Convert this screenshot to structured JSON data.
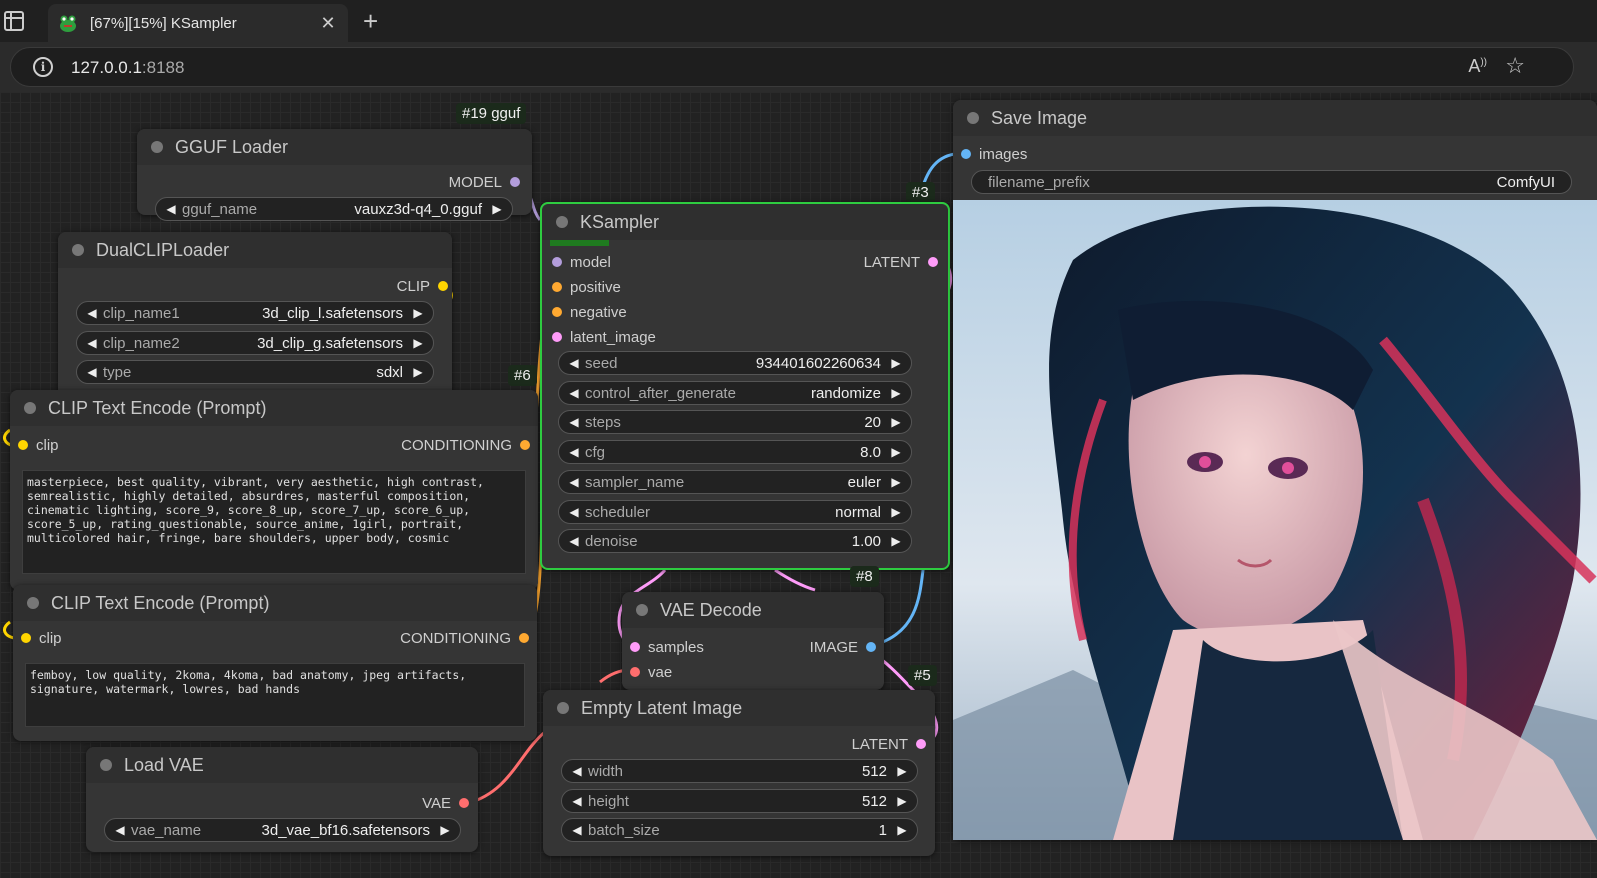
{
  "browser": {
    "tab_title": "[67%][15%] KSampler",
    "url_host": "127.0.0.1",
    "url_port": ":8188"
  },
  "nodes": {
    "gguf_loader": {
      "tag": "#19 gguf",
      "title": "GGUF Loader",
      "output": "MODEL",
      "widgets": [
        {
          "name": "gguf_name",
          "value": "vauxz3d-q4_0.gguf"
        }
      ]
    },
    "dualclip": {
      "title": "DualCLIPLoader",
      "output": "CLIP",
      "widgets": [
        {
          "name": "clip_name1",
          "value": "3d_clip_l.safetensors"
        },
        {
          "name": "clip_name2",
          "value": "3d_clip_g.safetensors"
        },
        {
          "name": "type",
          "value": "sdxl"
        }
      ]
    },
    "clip_pos": {
      "tag": "#6",
      "title": "CLIP Text Encode (Prompt)",
      "input": "clip",
      "output": "CONDITIONING",
      "text": "masterpiece, best quality, vibrant, very aesthetic, high contrast,\nsemrealistic, highly detailed, absurdres, masterful composition,\ncinematic lighting, score_9, score_8_up, score_7_up, score_6_up,\nscore_5_up, rating_questionable, source_anime, 1girl, portrait,\nmulticolored hair, fringe, bare shoulders, upper body, cosmic"
    },
    "clip_neg": {
      "title": "CLIP Text Encode (Prompt)",
      "input": "clip",
      "output": "CONDITIONING",
      "text": "femboy, low quality, 2koma, 4koma, bad anatomy, jpeg artifacts,\nsignature, watermark, lowres, bad hands"
    },
    "load_vae": {
      "title": "Load VAE",
      "output": "VAE",
      "widgets": [
        {
          "name": "vae_name",
          "value": "3d_vae_bf16.safetensors"
        }
      ]
    },
    "ksampler": {
      "tag": "#3",
      "title": "KSampler",
      "progress": 0.15,
      "inputs": [
        "model",
        "positive",
        "negative",
        "latent_image"
      ],
      "output": "LATENT",
      "widgets": [
        {
          "name": "seed",
          "value": "934401602260634"
        },
        {
          "name": "control_after_generate",
          "value": "randomize"
        },
        {
          "name": "steps",
          "value": "20"
        },
        {
          "name": "cfg",
          "value": "8.0"
        },
        {
          "name": "sampler_name",
          "value": "euler"
        },
        {
          "name": "scheduler",
          "value": "normal"
        },
        {
          "name": "denoise",
          "value": "1.00"
        }
      ]
    },
    "vae_decode": {
      "tag": "#8",
      "title": "VAE Decode",
      "inputs": [
        "samples",
        "vae"
      ],
      "output": "IMAGE"
    },
    "empty_latent": {
      "tag": "#5",
      "title": "Empty Latent Image",
      "output": "LATENT",
      "widgets": [
        {
          "name": "width",
          "value": "512"
        },
        {
          "name": "height",
          "value": "512"
        },
        {
          "name": "batch_size",
          "value": "1"
        }
      ]
    },
    "save_image": {
      "title": "Save Image",
      "input": "images",
      "widgets": [
        {
          "name": "filename_prefix",
          "value": "ComfyUI"
        }
      ]
    }
  },
  "colors": {
    "model": "#b39ddb",
    "clip": "#ffd500",
    "conditioning": "#ffa931",
    "latent": "#ff9cf9",
    "vae": "#ff6e6e",
    "image": "#64b5f6",
    "active_border": "#2ecc40"
  },
  "icons": [
    "sidebar-toggle-icon",
    "frog-favicon-icon",
    "close-icon",
    "plus-icon",
    "info-icon",
    "read-aloud-icon",
    "star-icon",
    "left-arrow-icon",
    "right-arrow-icon"
  ]
}
